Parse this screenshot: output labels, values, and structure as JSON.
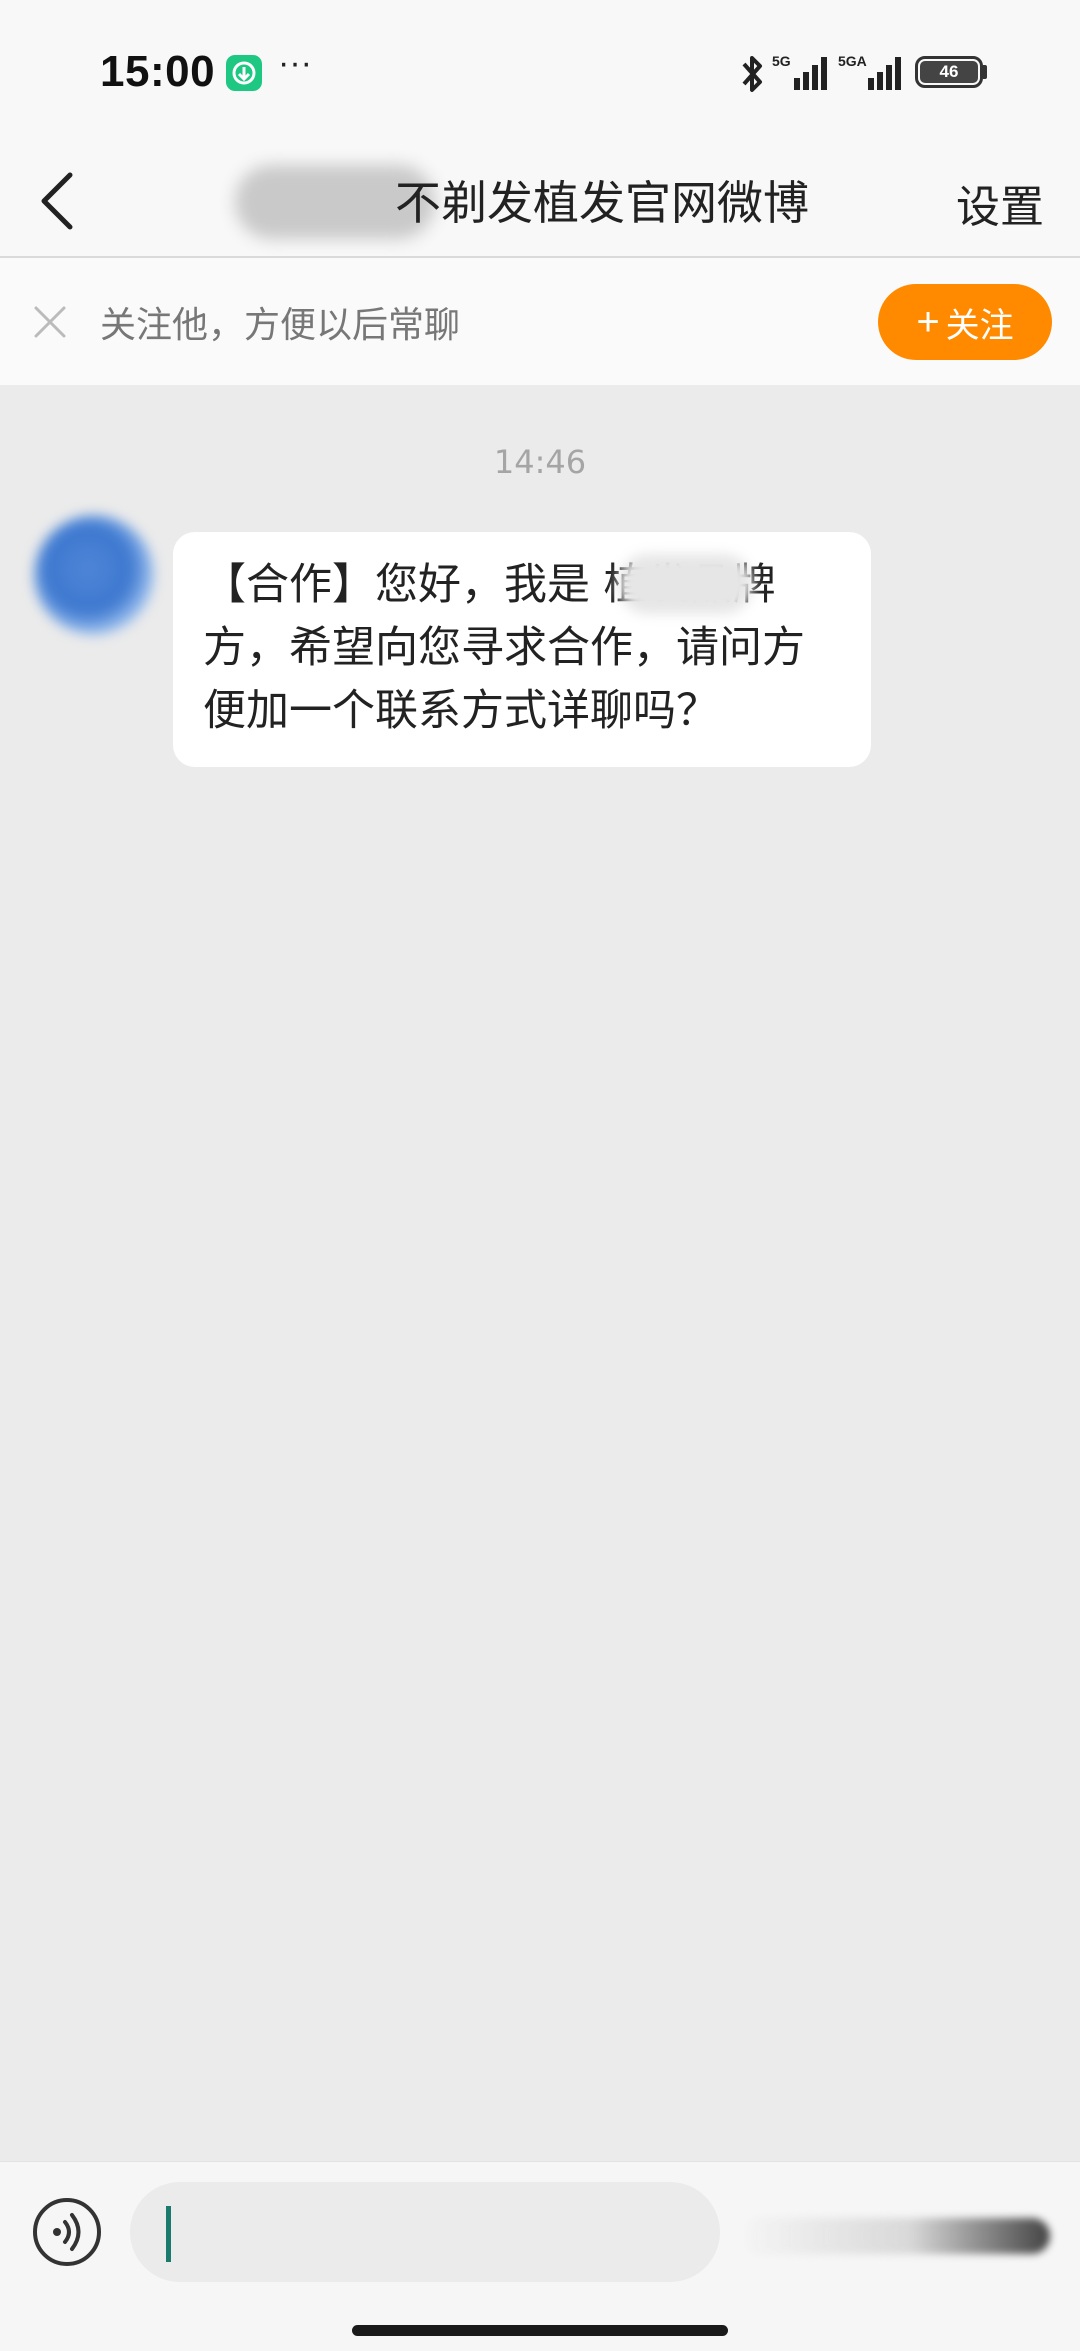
{
  "status_bar": {
    "time": "15:00",
    "more_label": "···",
    "net1": "5G",
    "net2": "5GA",
    "battery": "46"
  },
  "header": {
    "title": "不剃发植发官网微博",
    "settings_label": "设置"
  },
  "follow_bar": {
    "hint": "关注他，方便以后常聊",
    "follow_label": "关注",
    "accent_color": "#ff8a00"
  },
  "chat": {
    "timestamp": "14:46",
    "messages": [
      {
        "sender": "other",
        "text": "【合作】您好，我是 植发品牌方，希望向您寻求合作，请问方便加一个联系方式详聊吗？"
      }
    ]
  },
  "input": {
    "value": "",
    "placeholder": "",
    "caret_color": "#1a7a6c"
  }
}
